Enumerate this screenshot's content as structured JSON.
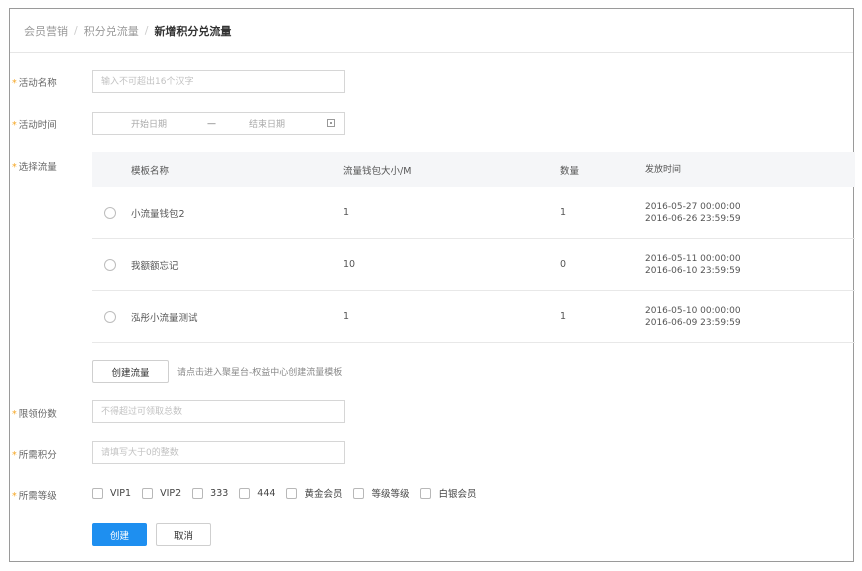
{
  "breadcrumb": {
    "items": [
      "会员营销",
      "积分兑流量"
    ],
    "separator": "/",
    "current": "新增积分兑流量"
  },
  "form": {
    "required_mark": "*",
    "activity_name": {
      "label": "活动名称",
      "placeholder": "输入不可超出16个汉字",
      "value": ""
    },
    "activity_time": {
      "label": "活动时间",
      "start_placeholder": "开始日期",
      "dash": "—",
      "end_placeholder": "结束日期"
    },
    "select_flow": {
      "label": "选择流量"
    },
    "limit_count": {
      "label": "限领份数",
      "placeholder": "不得超过可领取总数",
      "value": ""
    },
    "points_needed": {
      "label": "所需积分",
      "placeholder": "请填写大于0的整数",
      "value": ""
    },
    "level_needed": {
      "label": "所需等级"
    }
  },
  "flow_table": {
    "headers": [
      "模板名称",
      "流量钱包大小/M",
      "数量",
      "发放时间"
    ],
    "rows": [
      {
        "name": "小流量钱包2",
        "size": "1",
        "count": "1",
        "time_start": "2016-05-27 00:00:00",
        "time_end": "2016-06-26 23:59:59",
        "selected": false
      },
      {
        "name": "我额额忘记",
        "size": "10",
        "count": "0",
        "time_start": "2016-05-11 00:00:00",
        "time_end": "2016-06-10 23:59:59",
        "selected": false
      },
      {
        "name": "泓彤小流量测试",
        "size": "1",
        "count": "1",
        "time_start": "2016-05-10 00:00:00",
        "time_end": "2016-06-09 23:59:59",
        "selected": false
      }
    ]
  },
  "create_flow": {
    "button_label": "创建流量",
    "hint": "请点击进入聚星台-权益中心创建流量模板"
  },
  "levels": [
    {
      "label": "VIP1",
      "checked": false
    },
    {
      "label": "VIP2",
      "checked": false
    },
    {
      "label": "333",
      "checked": false
    },
    {
      "label": "444",
      "checked": false
    },
    {
      "label": "黄金会员",
      "checked": false
    },
    {
      "label": "等级等级",
      "checked": false
    },
    {
      "label": "白银会员",
      "checked": false
    }
  ],
  "actions": {
    "create_label": "创建",
    "cancel_label": "取消"
  },
  "colors": {
    "primary": "#1e8ff0",
    "required": "#f5a623",
    "table_header_bg": "#f5f6f8"
  }
}
